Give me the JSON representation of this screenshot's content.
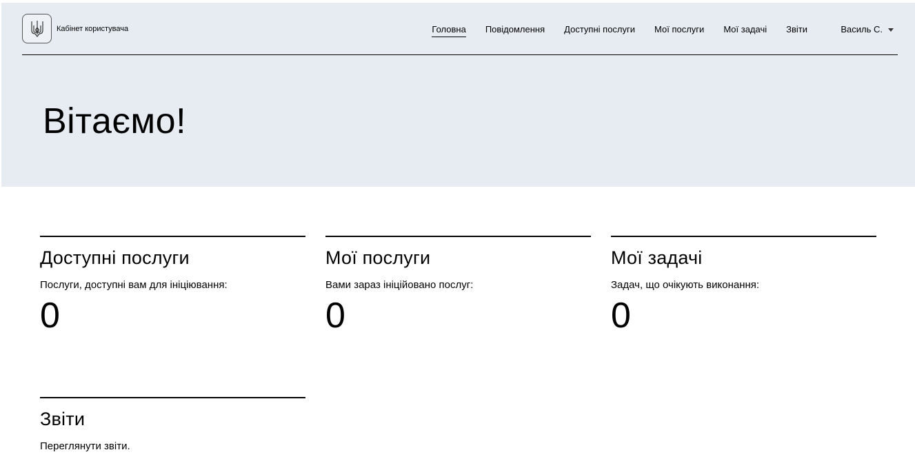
{
  "header": {
    "logo_icon": "trident-icon",
    "app_title": "Кабінет користувача",
    "nav": [
      {
        "label": "Головна",
        "active": true
      },
      {
        "label": "Повідомлення",
        "active": false
      },
      {
        "label": "Доступні послуги",
        "active": false
      },
      {
        "label": "Мої послуги",
        "active": false
      },
      {
        "label": "Мої задачі",
        "active": false
      },
      {
        "label": "Звіти",
        "active": false
      }
    ],
    "user": {
      "name": "Василь С.",
      "icon": "chevron-down-icon"
    }
  },
  "hero": {
    "greeting": "Вітаємо!",
    "background": "#e7ecf2"
  },
  "cards": [
    {
      "title": "Доступні послуги",
      "description": "Послуги, доступні вам для ініціювання:",
      "count": "0"
    },
    {
      "title": "Мої послуги",
      "description": "Вами зараз ініційовано послуг:",
      "count": "0"
    },
    {
      "title": "Мої задачі",
      "description": "Задач, що очікують виконання:",
      "count": "0"
    },
    {
      "title": "Звіти",
      "description": "Переглянути звіти."
    }
  ]
}
